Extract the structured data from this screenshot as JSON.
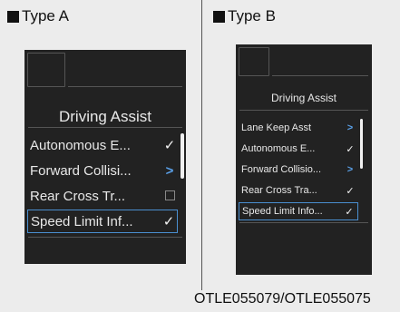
{
  "labels": {
    "type_a": "Type A",
    "type_b": "Type B",
    "caption": "OTLE055079/OTLE055075"
  },
  "screen_a": {
    "title": "Driving Assist",
    "items": [
      {
        "label": "Autonomous E...",
        "indicator": "checked",
        "indicator_glyph": "✓"
      },
      {
        "label": "Forward Collisi...",
        "indicator": "submenu",
        "indicator_glyph": ">"
      },
      {
        "label": "Rear Cross Tr...",
        "indicator": "unchecked",
        "indicator_glyph": ""
      },
      {
        "label": "Speed Limit Inf...",
        "indicator": "checked",
        "indicator_glyph": "✓"
      }
    ]
  },
  "screen_b": {
    "title": "Driving Assist",
    "items": [
      {
        "label": "Lane Keep Asst",
        "indicator": "submenu",
        "indicator_glyph": ">"
      },
      {
        "label": "Autonomous E...",
        "indicator": "checked",
        "indicator_glyph": "✓"
      },
      {
        "label": "Forward Collisio...",
        "indicator": "submenu",
        "indicator_glyph": ">"
      },
      {
        "label": "Rear Cross Tra...",
        "indicator": "checked",
        "indicator_glyph": "✓"
      },
      {
        "label": "Speed Limit Info...",
        "indicator": "checked",
        "indicator_glyph": "✓"
      }
    ]
  },
  "colors": {
    "screen_bg": "#222222",
    "text": "#e8e8e8",
    "chevron": "#5aa0e8",
    "selection": "#4a8fd0"
  },
  "icons": {
    "checked": "check-icon",
    "submenu": "chevron-right-icon",
    "unchecked": "empty-checkbox-icon"
  }
}
